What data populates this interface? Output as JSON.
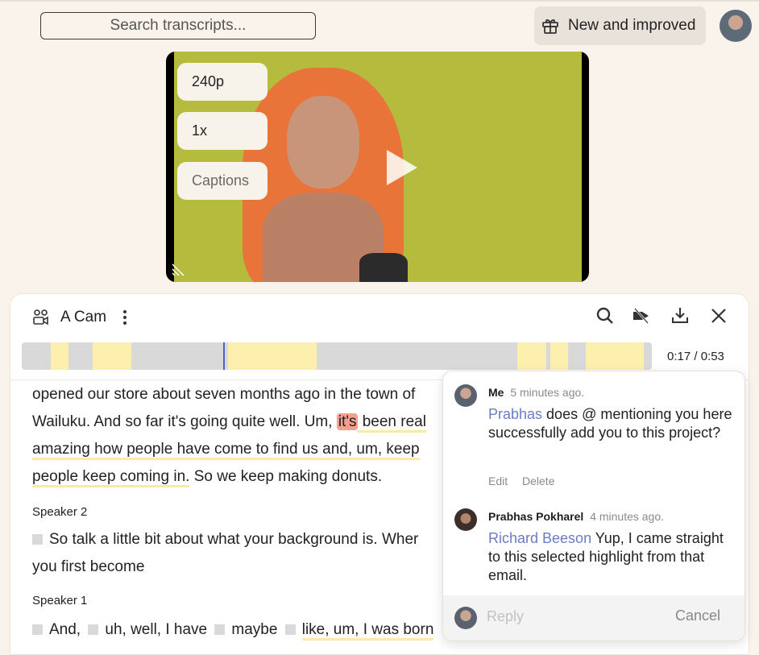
{
  "header": {
    "search_placeholder": "Search transcripts...",
    "new_button_label": "New and improved",
    "gift_icon": "gift-icon",
    "avatar_icon": "user-avatar"
  },
  "video": {
    "quality": "240p",
    "speed": "1x",
    "captions": "Captions",
    "play_icon": "play-icon"
  },
  "panel": {
    "camera_label": "A Cam",
    "timecode": "0:17 / 0:53",
    "tools": [
      "search-icon",
      "hide-icon",
      "download-icon",
      "close-icon"
    ]
  },
  "transcript": {
    "para1": {
      "l1": "opened our store about seven months ago in the town of",
      "l2_a": "Wailuku. And so far it's going quite well. Um, ",
      "l2_b": "it's",
      "l2_c": " been real",
      "l3": "amazing how people have come to find us and, um, keep",
      "l4_a": "people keep coming in.",
      "l4_b": " So we keep making donuts."
    },
    "speaker2": "Speaker 2",
    "para2": {
      "l1": "So talk a little bit about what your background is. Wher",
      "l2": "you first become"
    },
    "speaker1": "Speaker 1",
    "para3": {
      "w1": "And,",
      "w2": "uh, well, I have",
      "w3": "maybe",
      "w4": "like, um, I was born"
    }
  },
  "comments": [
    {
      "author": "Me",
      "time": "5 minutes ago.",
      "mention": "Prabhas",
      "text": " does @ mentioning you here successfully add you to this project?",
      "edit": "Edit",
      "delete": "Delete"
    },
    {
      "author": "Prabhas Pokharel",
      "time": "4 minutes ago.",
      "mention": "Richard Beeson",
      "text": " Yup, I came straight to this selected highlight from that email."
    }
  ],
  "reply": {
    "placeholder": "Reply",
    "cancel": "Cancel"
  }
}
